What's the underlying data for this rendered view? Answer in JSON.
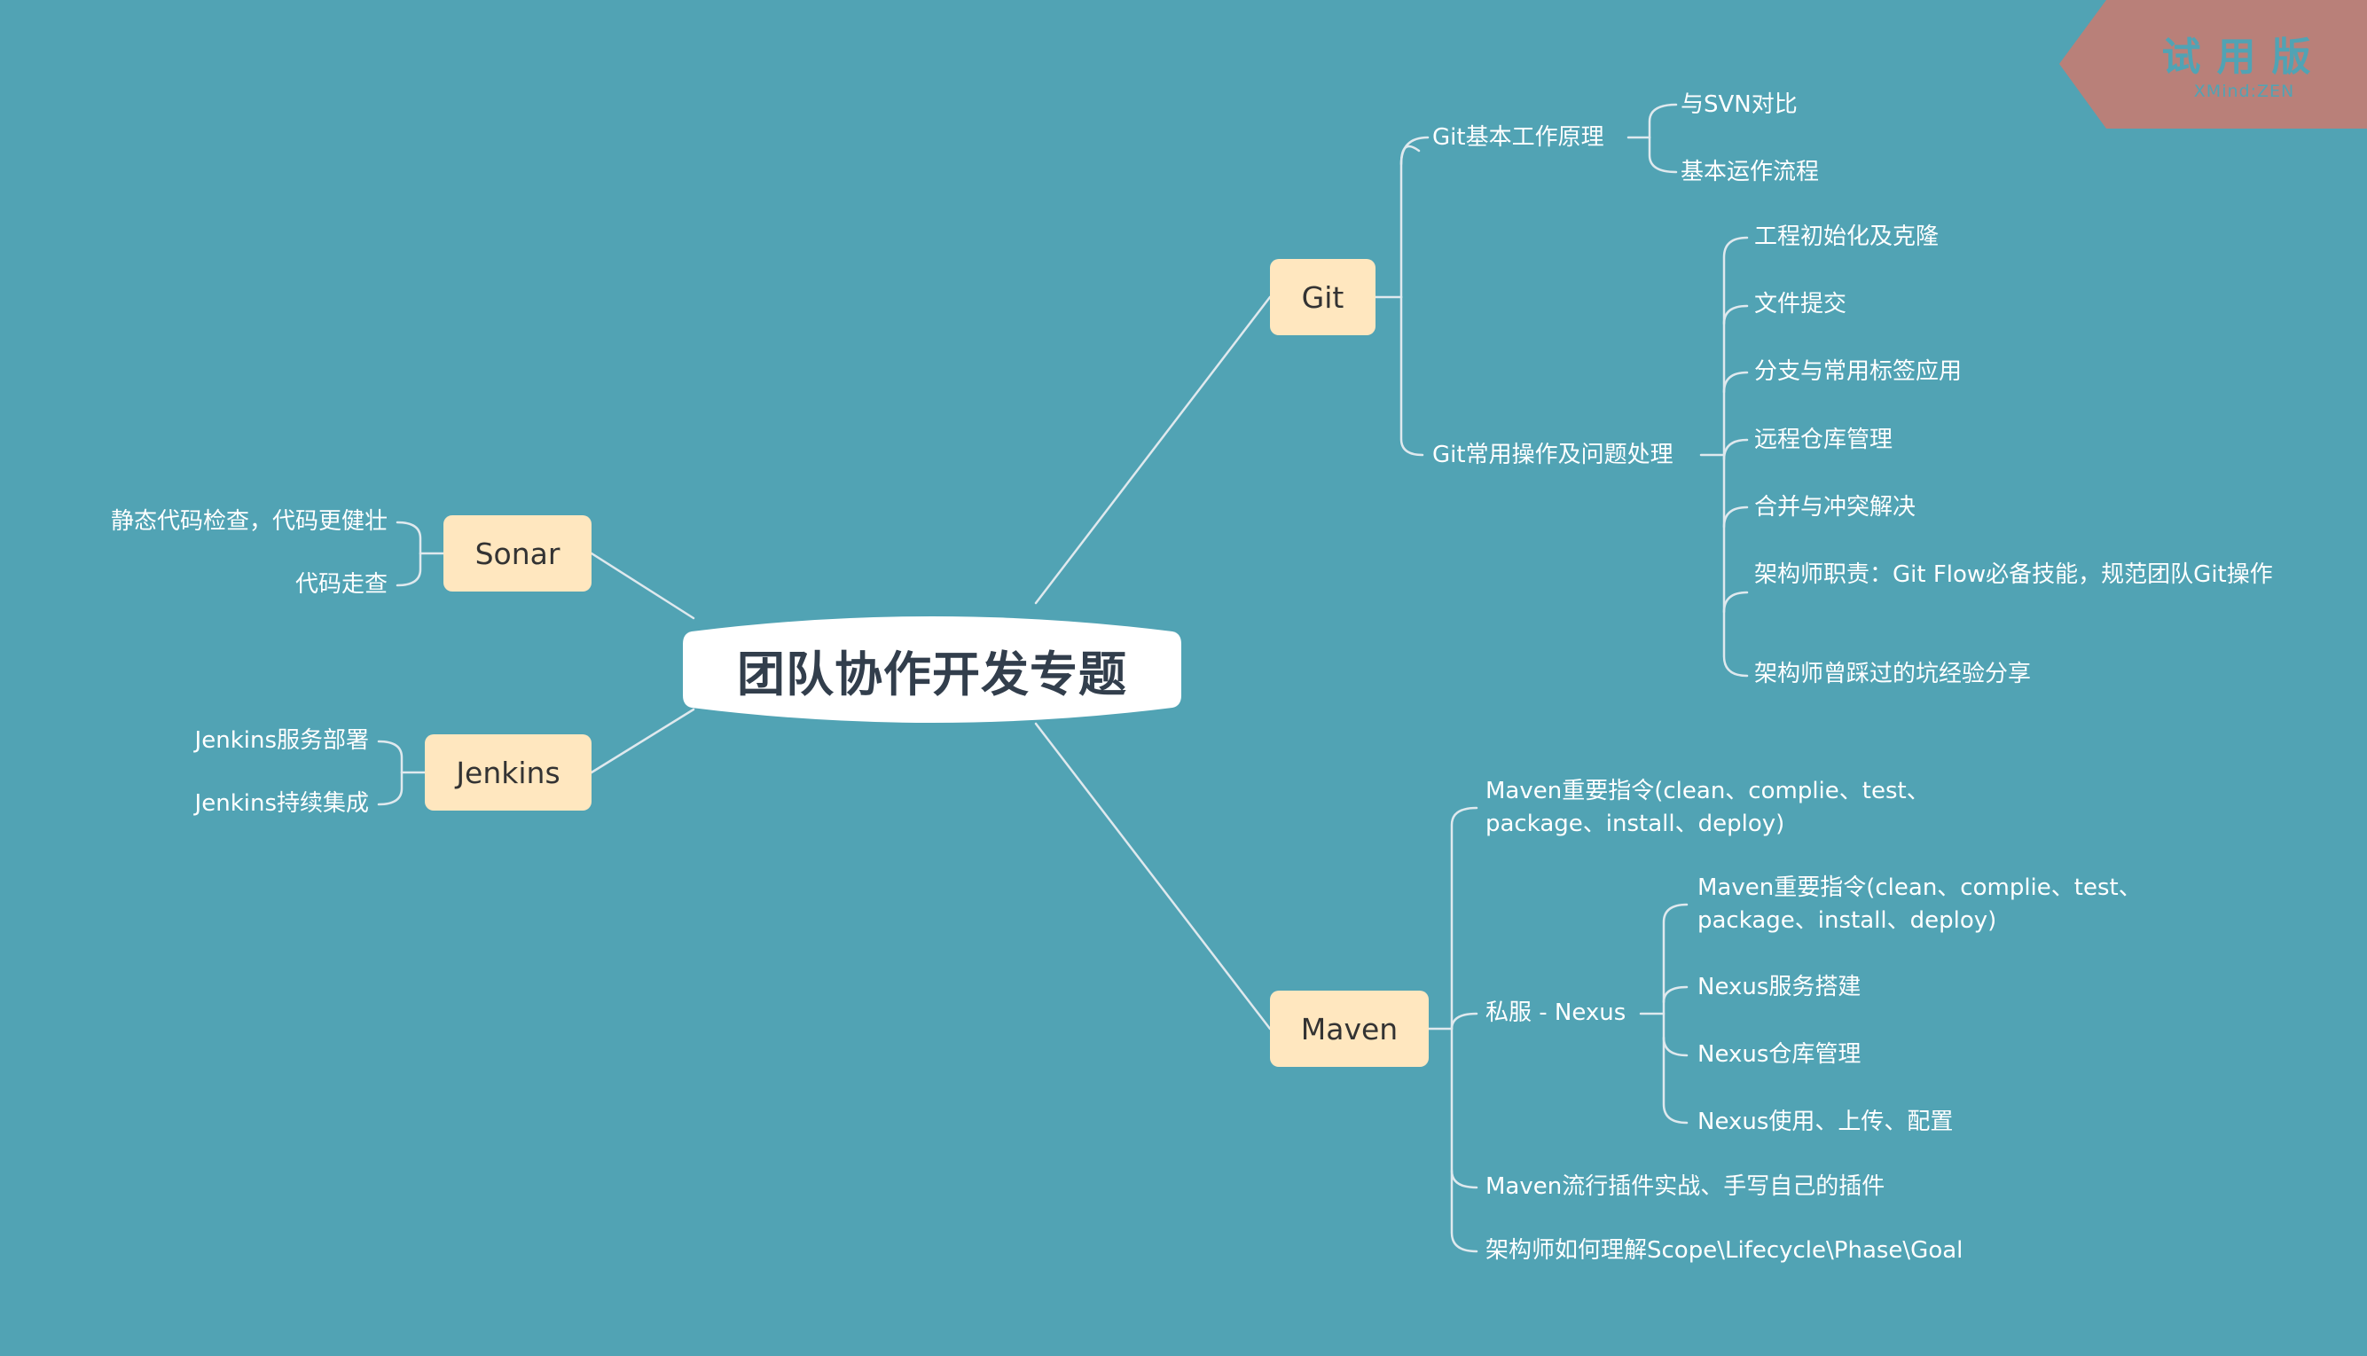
{
  "colors": {
    "background": "#51a3b4",
    "central_fill": "#ffffff",
    "central_text": "#323e4c",
    "main_topic_fill": "#ffe7bf",
    "main_topic_text": "#333333",
    "line": "#dfe9ee",
    "watermark_fill": "#b98079"
  },
  "watermark": {
    "title": "试用版",
    "subtitle": "XMind:ZEN"
  },
  "central_topic": "团队协作开发专题",
  "main_topics": {
    "git": {
      "label": "Git",
      "subtopics": [
        {
          "label": "Git基本工作原理",
          "children": [
            "与SVN对比",
            "基本运作流程"
          ]
        },
        {
          "label": "Git常用操作及问题处理",
          "children": [
            "工程初始化及克隆",
            "文件提交",
            "分支与常用标签应用",
            "远程仓库管理",
            "合并与冲突解决",
            "架构师职责：Git Flow必备技能，规范团队Git操作",
            "架构师曾踩过的坑经验分享"
          ]
        }
      ]
    },
    "maven": {
      "label": "Maven",
      "subtopics": [
        {
          "label": "Maven重要指令(clean、complie、test、package、install、deploy)",
          "line1": "Maven重要指令(clean、complie、test、",
          "line2": "package、install、deploy)"
        },
        {
          "label": "私服 - Nexus",
          "children": [
            {
              "line1": "Maven重要指令(clean、complie、test、",
              "line2": "package、install、deploy)"
            },
            "Nexus服务搭建",
            "Nexus仓库管理",
            "Nexus使用、上传、配置"
          ]
        },
        {
          "label": "Maven流行插件实战、手写自己的插件"
        },
        {
          "label": "架构师如何理解Scope\\Lifecycle\\Phase\\Goal"
        }
      ]
    },
    "sonar": {
      "label": "Sonar",
      "subtopics": [
        "静态代码检查，代码更健壮",
        "代码走查"
      ]
    },
    "jenkins": {
      "label": "Jenkins",
      "subtopics": [
        "Jenkins服务部署",
        "Jenkins持续集成"
      ]
    }
  }
}
